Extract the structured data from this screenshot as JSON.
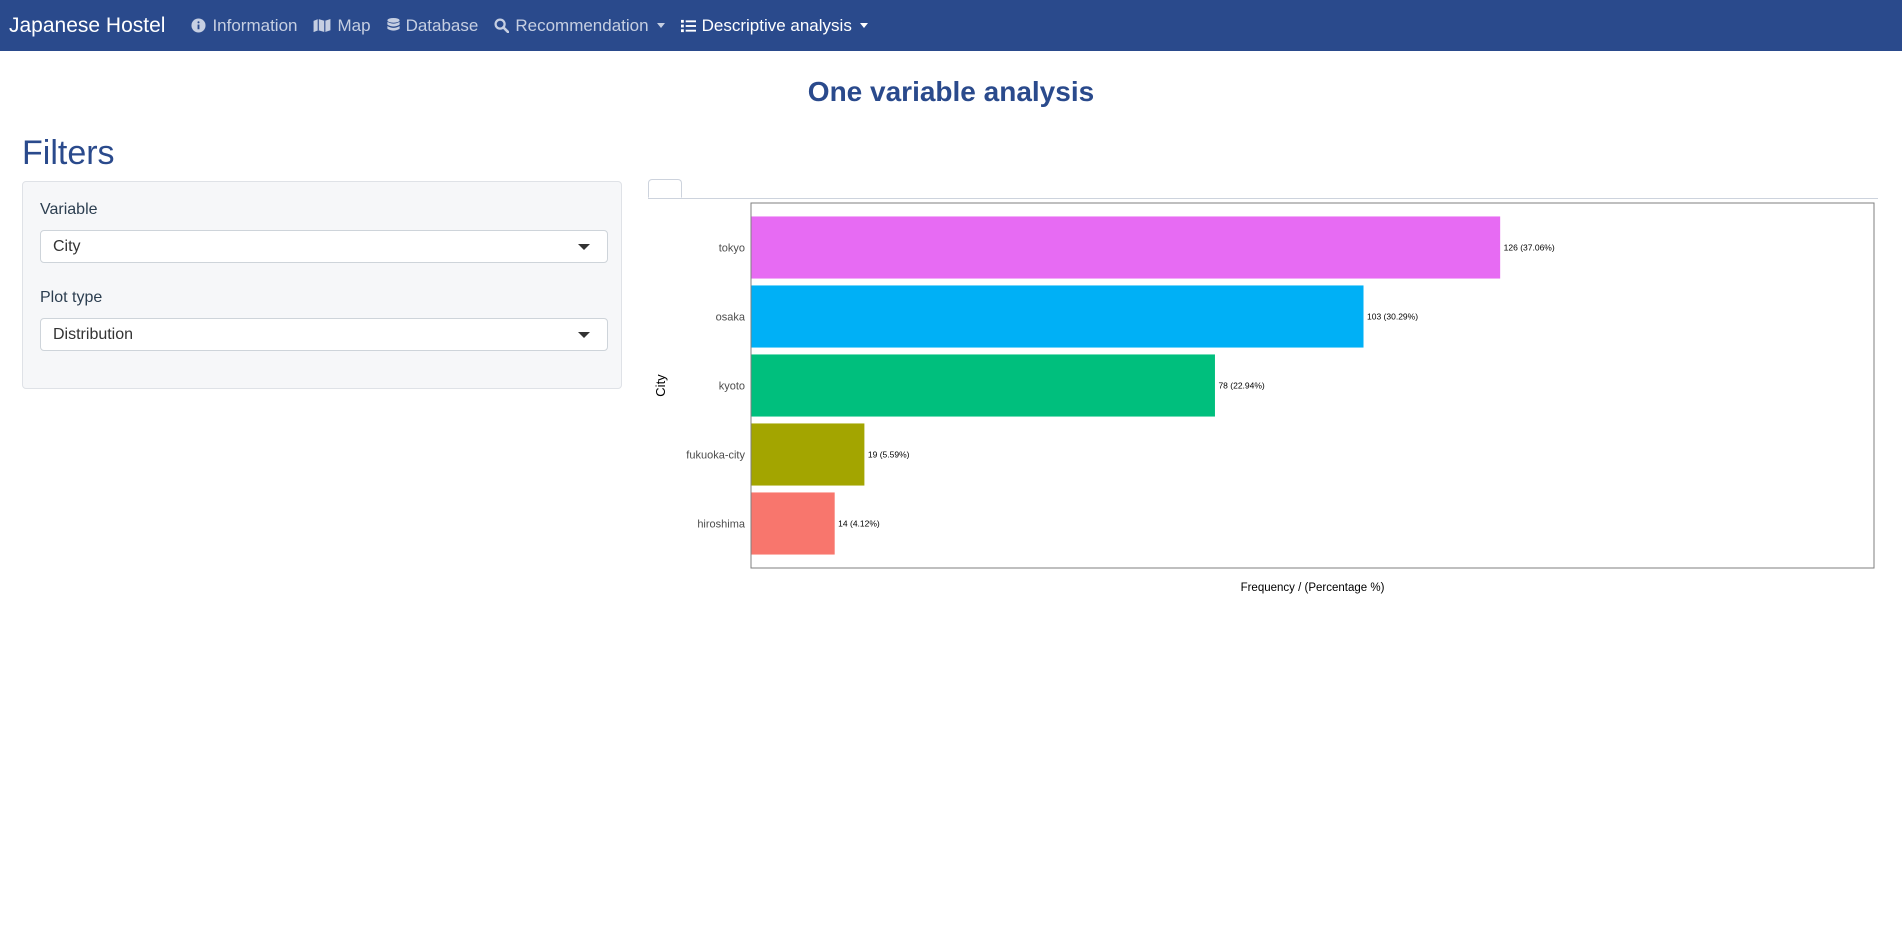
{
  "navbar": {
    "brand": "Japanese Hostel",
    "items": [
      {
        "label": "Information",
        "icon": "info-circle-icon"
      },
      {
        "label": "Map",
        "icon": "map-icon"
      },
      {
        "label": "Database",
        "icon": "database-icon"
      },
      {
        "label": "Recommendation",
        "icon": "search-icon",
        "dropdown": true
      },
      {
        "label": "Descriptive analysis",
        "icon": "list-icon",
        "dropdown": true,
        "active": true
      }
    ]
  },
  "main": {
    "title": "One variable analysis"
  },
  "filters": {
    "heading": "Filters",
    "variable_label": "Variable",
    "variable_value": "City",
    "plot_type_label": "Plot type",
    "plot_type_value": "Distribution"
  },
  "colors": {
    "navbar": "#2a4a8c",
    "heading": "#2a4a8c"
  },
  "chart_data": {
    "type": "bar",
    "orientation": "horizontal",
    "categories": [
      "tokyo",
      "osaka",
      "kyoto",
      "fukuoka-city",
      "hiroshima"
    ],
    "values": [
      126,
      103,
      78,
      19,
      14
    ],
    "labels": [
      "126 (37.06%)",
      "103 (30.29%)",
      "78 (22.94%)",
      "19 (5.59%)",
      "14 (4.12%)"
    ],
    "colors": [
      "#e76bf3",
      "#00b0f6",
      "#00bf7d",
      "#a3a500",
      "#f8766d"
    ],
    "xlabel": "Frequency / (Percentage %)",
    "ylabel": "City",
    "xlim": [
      0,
      189
    ],
    "grid": false,
    "legend": "none"
  }
}
